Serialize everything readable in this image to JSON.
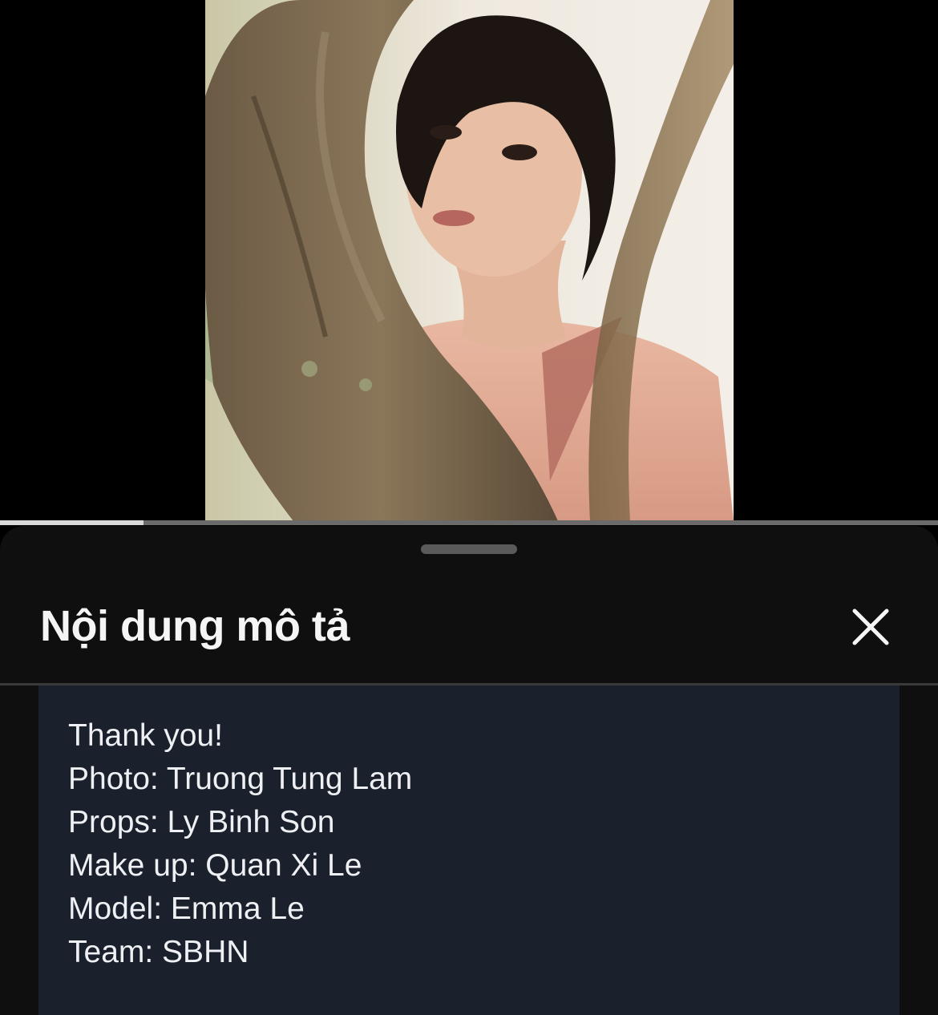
{
  "player": {
    "progress_fraction": 0.153,
    "progress_color": "#d9d9d9",
    "track_color": "#6b6b6b"
  },
  "sheet": {
    "title": "Nội dung mô tả",
    "close_icon": "close-icon",
    "description_lines": [
      "Thank you!",
      "Photo: Truong Tung Lam",
      "Props: Ly Binh Son",
      "Make up: Quan Xi Le",
      "Model: Emma Le",
      "Team: SBHN"
    ],
    "background_color": "#0f0f0f",
    "description_background": "#1a212d"
  }
}
